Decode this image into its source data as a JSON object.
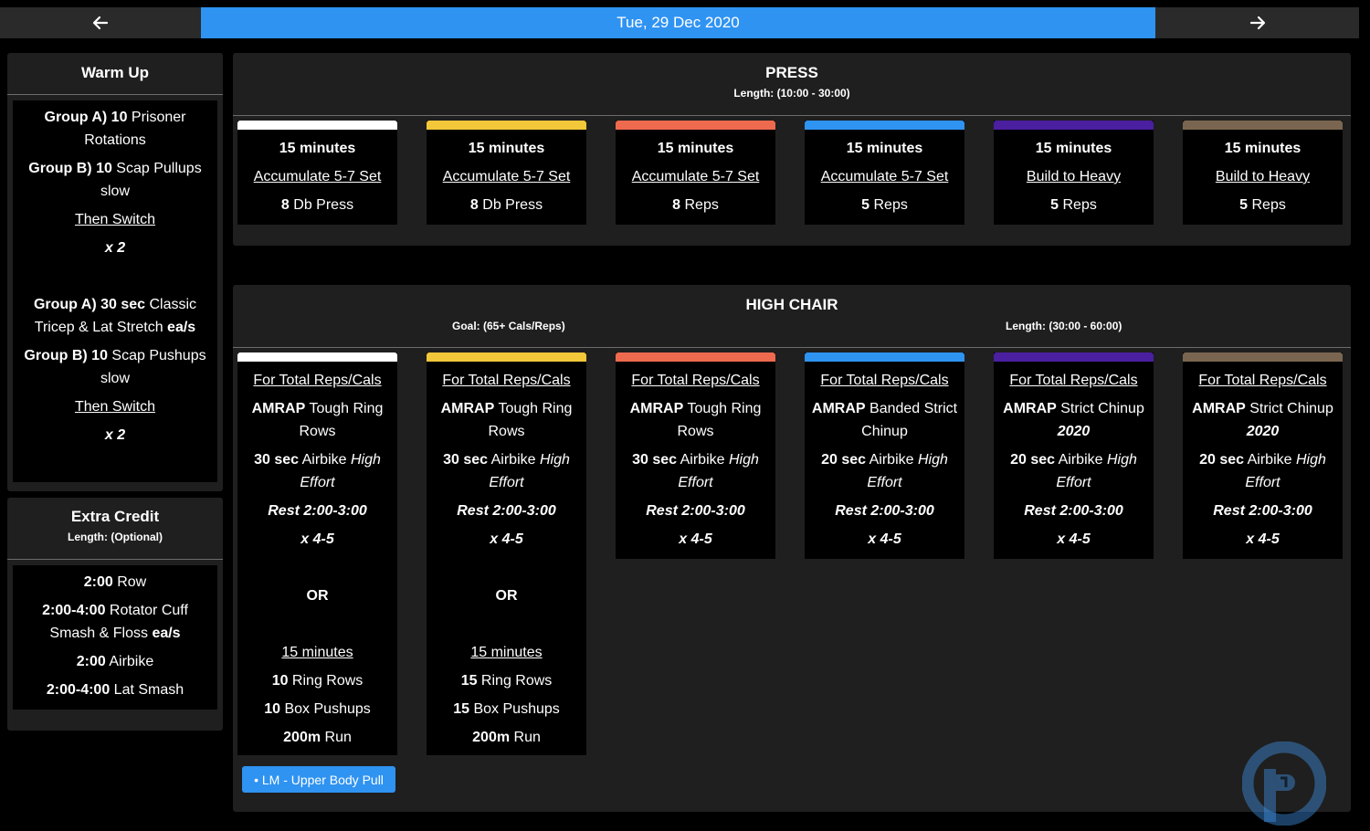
{
  "nav": {
    "date": "Tue, 29 Dec 2020"
  },
  "colors": {
    "accent": "#2f93f2",
    "white": "#ffffff",
    "yellow": "#f2c73a",
    "orange": "#ee6a4f",
    "blue": "#2f93f2",
    "purple": "#4a1fa0",
    "brown": "#7a6650"
  },
  "warmup": {
    "title": "Warm Up",
    "lines": [
      {
        "a": "Group A)  10",
        "b": " Prisoner Rotations"
      },
      {
        "a": "Group B)  10",
        "b": " Scap Pullups slow"
      },
      {
        "u": "Then Switch"
      },
      {
        "i": "x 2"
      },
      {
        "gap": true
      },
      {
        "a": "Group A)  30 sec",
        "b": " Classic Tricep & Lat Stretch ",
        "c": "ea/s"
      },
      {
        "a": "Group B)  10",
        "b": " Scap Pushups slow"
      },
      {
        "u": "Then Switch"
      },
      {
        "i": "x 2"
      }
    ]
  },
  "extra": {
    "title": "Extra Credit",
    "length": "Length: (Optional)",
    "lines": [
      {
        "a": "2:00",
        "b": "  Row"
      },
      {
        "a": "2:00-4:00",
        "b": "  Rotator Cuff Smash & Floss ",
        "c": "ea/s"
      },
      {
        "a": "2:00",
        "b": "  Airbike"
      },
      {
        "a": "2:00-4:00",
        "b": "  Lat Smash"
      }
    ]
  },
  "press": {
    "title": "PRESS",
    "length": "Length: (10:00 - 30:00)",
    "cards": [
      {
        "color": "#ffffff",
        "duration": "15 minutes",
        "scheme": "Accumulate 5-7 Set",
        "num": "8",
        "move": " Db Press"
      },
      {
        "color": "#f2c73a",
        "duration": "15 minutes",
        "scheme": "Accumulate 5-7 Set",
        "num": "8",
        "move": " Db Press"
      },
      {
        "color": "#ee6a4f",
        "duration": "15 minutes",
        "scheme": "Accumulate 5-7 Set",
        "num": "8",
        "move": " Reps"
      },
      {
        "color": "#2f93f2",
        "duration": "15 minutes",
        "scheme": "Accumulate 5-7 Set",
        "num": "5",
        "move": " Reps"
      },
      {
        "color": "#4a1fa0",
        "duration": "15 minutes",
        "scheme": "Build to Heavy",
        "num": "5",
        "move": " Reps"
      },
      {
        "color": "#7a6650",
        "duration": "15 minutes",
        "scheme": "Build to Heavy",
        "num": "5",
        "move": " Reps"
      }
    ]
  },
  "highchair": {
    "title": "HIGH CHAIR",
    "goal": "Goal: (65+ Cals/Reps)",
    "length": "Length: (30:00 - 60:00)",
    "tag": "• LM - Upper Body Pull",
    "cards": [
      {
        "color": "#ffffff",
        "lines": [
          {
            "u": "For Total Reps/Cals "
          },
          {
            "a": "AMRAP",
            "b": " Tough Ring Rows"
          },
          {
            "a": "30 sec",
            "b": " Airbike ",
            "i": "High Effort"
          },
          {
            "i": "Rest 2:00-3:00"
          },
          {
            "i": "x 4-5"
          },
          {
            "gap": true
          },
          {
            "a": "OR"
          },
          {
            "gap": true
          },
          {
            "u": "15 minutes"
          },
          {
            "a": "10",
            "b": " Ring Rows"
          },
          {
            "a": "10",
            "b": " Box Pushups"
          },
          {
            "a": "200m",
            "b": " Run"
          }
        ]
      },
      {
        "color": "#f2c73a",
        "lines": [
          {
            "u": "For Total Reps/Cals "
          },
          {
            "a": "AMRAP",
            "b": " Tough Ring Rows"
          },
          {
            "a": "30 sec",
            "b": " Airbike ",
            "i": "High Effort"
          },
          {
            "i": "Rest 2:00-3:00"
          },
          {
            "i": "x 4-5"
          },
          {
            "gap": true
          },
          {
            "a": "OR"
          },
          {
            "gap": true
          },
          {
            "u": "15 minutes"
          },
          {
            "a": "15",
            "b": " Ring Rows"
          },
          {
            "a": "15",
            "b": " Box Pushups"
          },
          {
            "a": "200m",
            "b": " Run"
          }
        ]
      },
      {
        "color": "#ee6a4f",
        "lines": [
          {
            "u": "For Total Reps/Cals "
          },
          {
            "a": "AMRAP",
            "b": " Tough Ring Rows"
          },
          {
            "a": "30 sec",
            "b": " Airbike ",
            "i": "High Effort"
          },
          {
            "i": "Rest 2:00-3:00"
          },
          {
            "i": "x 4-5"
          }
        ]
      },
      {
        "color": "#2f93f2",
        "lines": [
          {
            "u": "For Total Reps/Cals "
          },
          {
            "a": "AMRAP",
            "b": " Banded Strict Chinup"
          },
          {
            "a": "20 sec",
            "b": " Airbike ",
            "i": "High Effort"
          },
          {
            "i": "Rest 2:00-3:00"
          },
          {
            "i": "x 4-5"
          }
        ]
      },
      {
        "color": "#4a1fa0",
        "lines": [
          {
            "u": "For Total Reps/Cals "
          },
          {
            "a": "AMRAP",
            "b": " Strict Chinup ",
            "bi": "2020"
          },
          {
            "a": "20 sec",
            "b": " Airbike ",
            "i": "High Effort"
          },
          {
            "i": "Rest 2:00-3:00"
          },
          {
            "i": "x 4-5"
          }
        ]
      },
      {
        "color": "#7a6650",
        "lines": [
          {
            "u": "For Total Reps/Cals "
          },
          {
            "a": "AMRAP",
            "b": " Strict Chinup ",
            "bi": "2020"
          },
          {
            "a": "20 sec",
            "b": " Airbike ",
            "i": "High Effort"
          },
          {
            "i": "Rest 2:00-3:00"
          },
          {
            "i": "x 4-5"
          }
        ]
      }
    ]
  }
}
